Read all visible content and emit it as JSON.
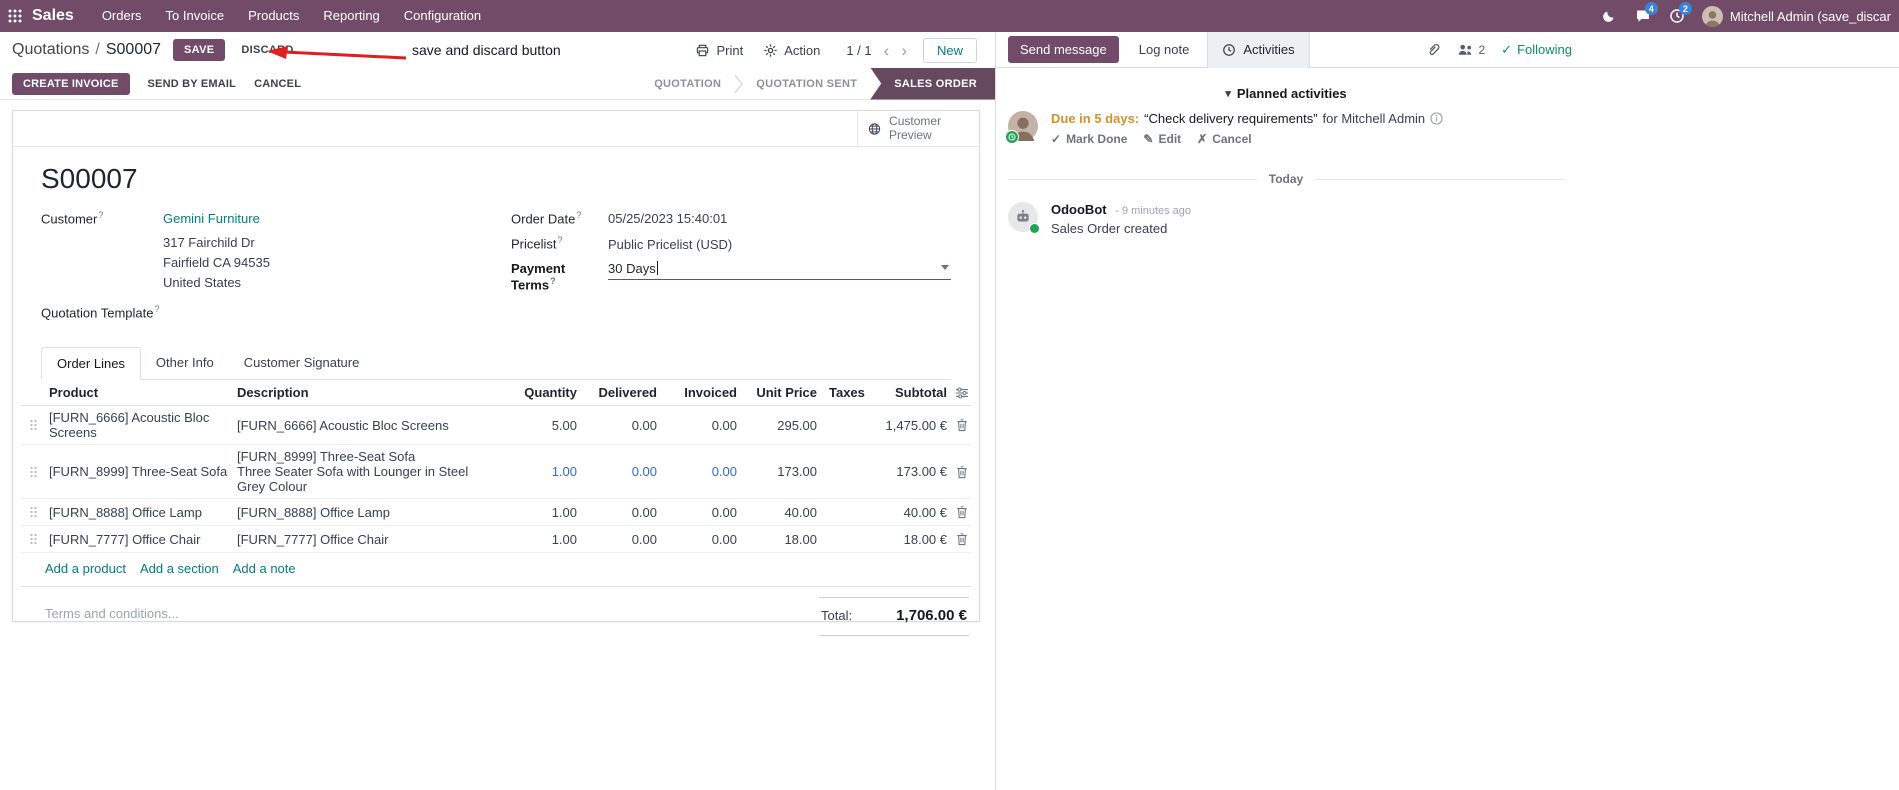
{
  "nav": {
    "brand": "Sales",
    "menus": [
      "Orders",
      "To Invoice",
      "Products",
      "Reporting",
      "Configuration"
    ],
    "badge_messages": "4",
    "badge_activities": "2",
    "user": "Mitchell Admin (save_discar"
  },
  "breadcrumb": {
    "path": "Quotations",
    "separator": "/",
    "record": "S00007",
    "save": "SAVE",
    "discard": "DISCARD",
    "annotation": "save and discard button",
    "print": "Print",
    "action": "Action",
    "pager": "1 / 1",
    "new": "New"
  },
  "statusbar": {
    "buttons": [
      "CREATE INVOICE",
      "SEND BY EMAIL",
      "CANCEL"
    ],
    "stages": [
      "QUOTATION",
      "QUOTATION SENT",
      "SALES ORDER"
    ],
    "active_stage": "SALES ORDER"
  },
  "sheet": {
    "preview_button": "Customer Preview",
    "title": "S00007",
    "customer_label": "Customer",
    "customer": "Gemini Furniture",
    "address": [
      "317 Fairchild Dr",
      "Fairfield CA 94535",
      "United States"
    ],
    "quotation_template_label": "Quotation Template",
    "order_date_label": "Order Date",
    "order_date": "05/25/2023 15:40:01",
    "pricelist_label": "Pricelist",
    "pricelist": "Public Pricelist (USD)",
    "payment_terms_label": "Payment Terms",
    "payment_terms": "30 Days",
    "tabs": [
      "Order Lines",
      "Other Info",
      "Customer Signature"
    ],
    "table": {
      "headers": [
        "Product",
        "Description",
        "Quantity",
        "Delivered",
        "Invoiced",
        "Unit Price",
        "Taxes",
        "Subtotal"
      ],
      "rows": [
        {
          "product": "[FURN_6666] Acoustic Bloc Screens",
          "description": "[FURN_6666] Acoustic Bloc Screens",
          "description2": "",
          "quantity": "5.00",
          "delivered": "0.00",
          "invoiced": "0.00",
          "unit_price": "295.00",
          "taxes": "",
          "subtotal": "1,475.00 €"
        },
        {
          "product": "[FURN_8999] Three-Seat Sofa",
          "description": "[FURN_8999] Three-Seat Sofa",
          "description2": "Three Seater Sofa with Lounger in Steel Grey Colour",
          "quantity": "1.00",
          "delivered": "0.00",
          "invoiced": "0.00",
          "unit_price": "173.00",
          "taxes": "",
          "subtotal": "173.00 €"
        },
        {
          "product": "[FURN_8888] Office Lamp",
          "description": "[FURN_8888] Office Lamp",
          "description2": "",
          "quantity": "1.00",
          "delivered": "0.00",
          "invoiced": "0.00",
          "unit_price": "40.00",
          "taxes": "",
          "subtotal": "40.00 €"
        },
        {
          "product": "[FURN_7777] Office Chair",
          "description": "[FURN_7777] Office Chair",
          "description2": "",
          "quantity": "1.00",
          "delivered": "0.00",
          "invoiced": "0.00",
          "unit_price": "18.00",
          "taxes": "",
          "subtotal": "18.00 €"
        }
      ],
      "links": [
        "Add a product",
        "Add a section",
        "Add a note"
      ]
    },
    "terms_placeholder": "Terms and conditions...",
    "total_label": "Total:",
    "total": "1,706.00 €"
  },
  "chatter": {
    "send_message": "Send message",
    "log_note": "Log note",
    "activities_tab": "Activities",
    "followers_count": "2",
    "following": "Following",
    "planned_header": "Planned activities",
    "activity": {
      "due": "Due in 5 days:",
      "summary": "“Check delivery requirements”",
      "for_user": "for Mitchell Admin",
      "mark_done": "Mark Done",
      "edit": "Edit",
      "cancel": "Cancel"
    },
    "today": "Today",
    "message": {
      "author": "OdooBot",
      "time": "- 9 minutes ago",
      "body": "Sales Order created"
    }
  },
  "icons": {
    "check": "✓",
    "pencil": "✎",
    "cross": "✗",
    "caret_down": "▾",
    "chevron_left": "‹",
    "chevron_right": "›",
    "question": "?"
  },
  "colors": {
    "primary": "#714B67",
    "link_teal": "#017E84",
    "edited_value": "#2D6CDD",
    "due_orange": "#D98F2B",
    "annotation_red": "#DF1F1F",
    "badge_blue": "#3B82D8",
    "success_green": "#21A353"
  }
}
